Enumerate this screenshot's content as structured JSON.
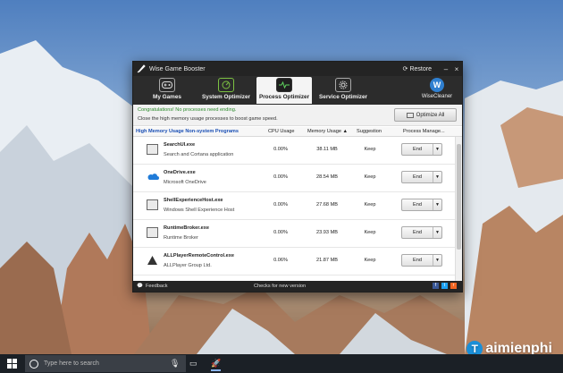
{
  "window": {
    "title": "Wise Game Booster",
    "restore_label": "Restore",
    "minimize_glyph": "–",
    "close_glyph": "×"
  },
  "tabs": [
    {
      "label": "My Games",
      "icon": "gamepad-icon"
    },
    {
      "label": "System Optimizer",
      "icon": "gauge-icon"
    },
    {
      "label": "Process Optimizer",
      "icon": "pulse-monitor-icon",
      "active": true
    },
    {
      "label": "Service Optimizer",
      "icon": "gear-icon"
    }
  ],
  "brand": {
    "initial": "W",
    "label": "WiseCleaner"
  },
  "banner": {
    "congrats": "Congratulations! No processes need ending.",
    "hint": "Close the high memory usage processes to boost game speed.",
    "optimize_label": "Optimize All"
  },
  "table": {
    "headers": {
      "name": "High Memory Usage Non-system Programs",
      "cpu": "CPU Usage",
      "mem": "Memory Usage ▲",
      "suggestion": "Suggestion",
      "manage": "Process Manage..."
    },
    "rows": [
      {
        "name": "SearchUI.exe",
        "desc": "Search and Cortana application",
        "cpu": "0.00%",
        "mem": "38.11 MB",
        "suggestion": "Keep",
        "action": "End"
      },
      {
        "name": "OneDrive.exe",
        "desc": "Microsoft OneDrive",
        "cpu": "0.00%",
        "mem": "28.54 MB",
        "suggestion": "Keep",
        "action": "End"
      },
      {
        "name": "ShellExperienceHost.exe",
        "desc": "Windows Shell Experience Host",
        "cpu": "0.00%",
        "mem": "27.68 MB",
        "suggestion": "Keep",
        "action": "End"
      },
      {
        "name": "RuntimeBroker.exe",
        "desc": "Runtime Broker",
        "cpu": "0.00%",
        "mem": "23.93 MB",
        "suggestion": "Keep",
        "action": "End"
      },
      {
        "name": "ALLPlayerRemoteControl.exe",
        "desc": "ALLPlayer Group Ltd.",
        "cpu": "0.06%",
        "mem": "21.87 MB",
        "suggestion": "Keep",
        "action": "End"
      }
    ]
  },
  "status": {
    "feedback": "Feedback",
    "checks": "Checks for new version"
  },
  "taskbar": {
    "search_placeholder": "Type here to search"
  },
  "watermark": {
    "initial": "T",
    "text": "aimienphi"
  },
  "colors": {
    "accent": "#1a4fb5",
    "green_text": "#2a8a2a",
    "dark_chrome": "#242424"
  }
}
